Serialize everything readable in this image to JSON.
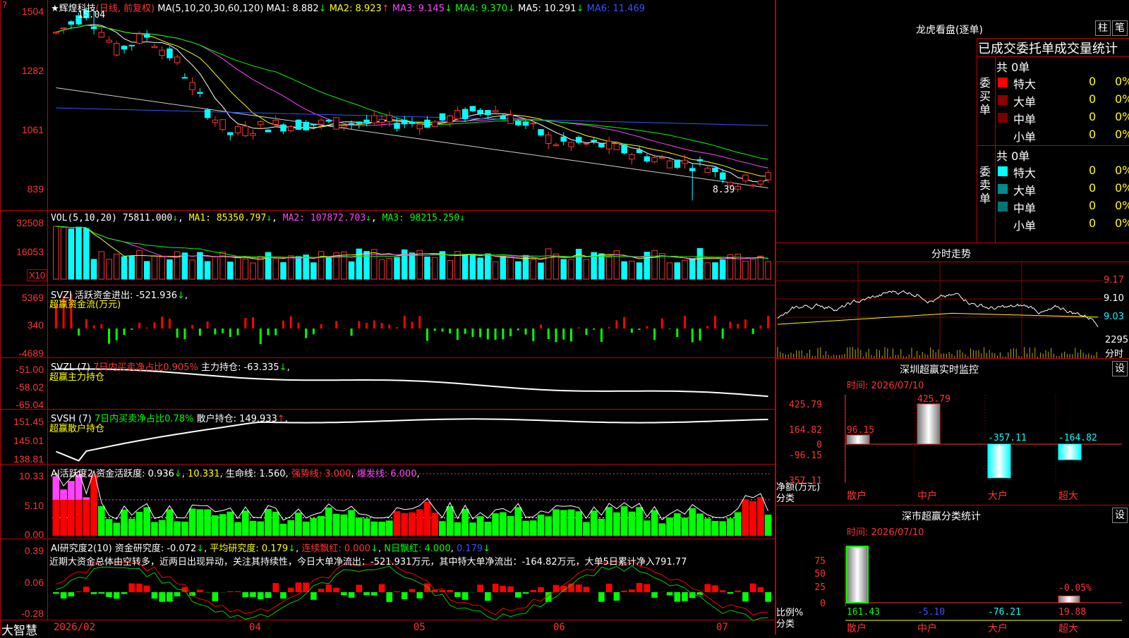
{
  "corner_mark": "?",
  "main": {
    "header": {
      "star": "★",
      "name": "辉煌科技",
      "period": "(日线, 前复权)",
      "ma_label": "MA(5,10,20,30,60,120)",
      "ma1": "MA1: 8.882",
      "ma2": "MA2: 8.923",
      "ma3": "MA3: 9.145",
      "ma4": "MA4: 9.370",
      "ma5": "MA5: 10.291",
      "ma6": "MA6: 11.469"
    },
    "high_label": "15.04",
    "low_label": "8.39",
    "yticks": [
      "1504",
      "1282",
      "1061",
      "839"
    ]
  },
  "vol": {
    "label": "VOL(5,10,20)",
    "value": "75811.000",
    "ma1": "MA1: 85350.797",
    "ma2": "MA2: 107872.703",
    "ma3": "MA3: 98215.250",
    "yticks": [
      "32508",
      "16053"
    ],
    "unit": "X10"
  },
  "svzj": {
    "label": "SVZJ",
    "title": "活跃资金进出: -521.936",
    "sub": "超赢资金流(万元)",
    "yticks": [
      "5369",
      "340",
      "-4689"
    ]
  },
  "svzl": {
    "label": "SVZL (7)",
    "ratio": "7日内买卖净占比0.905%",
    "hold": "主力持仓: -63.335",
    "sub": "超赢主力持仓",
    "yticks": [
      "-51.00",
      "-58.02",
      "-65.04"
    ]
  },
  "svsh": {
    "label": "SVSH (7)",
    "ratio": "7日内买卖净占比0.78%",
    "hold": "散户持仓: 149.933",
    "sub": "超赢散户持仓",
    "yticks": [
      "151.45",
      "145.01",
      "138.81"
    ]
  },
  "ai1": {
    "label": "AI活跃度2",
    "v1": "资金活跃度: 0.936",
    "v2": "10.331",
    "v3": "生命线: 1.560",
    "v4": "强势线: 3.000",
    "v5": "爆发线: 6.000",
    "yticks": [
      "10.33",
      "5.10",
      "0.00"
    ]
  },
  "ai2": {
    "label": "AI研究度2(10)",
    "v1": "资金研究度: -0.072",
    "v2": "平均研究度: 0.179",
    "v3": "连续飘红: 0.000",
    "v4": "N日飘红: 4.000",
    "v5": "0.179",
    "text": "近期大资金总体由空转多，近两日出现异动，关注其持续性，今日大单净流出：-521.931万元，其中特大单净流出：-164.82万元，大单5日累计净入791.77",
    "yticks": [
      "0.39",
      "0.06",
      "-0.28"
    ]
  },
  "xaxis": {
    "dates": [
      "2026/02",
      "04",
      "05",
      "06",
      "07"
    ],
    "logo": "大智慧"
  },
  "right": {
    "title": "龙虎看盘(逐单)",
    "btn_bar": "柱",
    "btn_pen": "笔",
    "stat_header": "已成交委托单成交量统计",
    "buy": {
      "group_label": "委买单",
      "total": "共 0单",
      "rows": [
        {
          "name": "特大",
          "val": "0",
          "pct": "0%"
        },
        {
          "name": "大单",
          "val": "0",
          "pct": "0%"
        },
        {
          "name": "中单",
          "val": "0",
          "pct": "0%"
        },
        {
          "name": "小单",
          "val": "0",
          "pct": "0%"
        }
      ]
    },
    "sell": {
      "group_label": "委卖单",
      "total": "共 0单",
      "rows": [
        {
          "name": "特大",
          "val": "0",
          "pct": "0%"
        },
        {
          "name": "大单",
          "val": "0",
          "pct": "0%"
        },
        {
          "name": "中单",
          "val": "0",
          "pct": "0%"
        },
        {
          "name": "小单",
          "val": "0",
          "pct": "0%"
        }
      ]
    },
    "intraday": {
      "title": "分时走势",
      "prices": [
        "9.17",
        "9.10",
        "9.03"
      ],
      "vol": "2295",
      "vol_unit": "分时"
    },
    "monitor": {
      "title": "深圳超赢实时监控",
      "set": "设",
      "time": "时间: 2026/07/10",
      "yticks": [
        "425.79",
        "164.82",
        "0",
        "-96.15",
        "-357.11"
      ],
      "bars": [
        {
          "label": "散户",
          "value": "96.15"
        },
        {
          "label": "中户",
          "value": "425.79"
        },
        {
          "label": "大户",
          "value": "-357.11"
        },
        {
          "label": "超大",
          "value": "-164.82"
        }
      ],
      "ylabel1": "净额(万元)",
      "ylabel2": "分类"
    },
    "category": {
      "title": "深市超赢分类统计",
      "set": "设",
      "time": "时间: 2026/07/10",
      "yticks": [
        "75",
        "50",
        "25",
        "0"
      ],
      "bars": [
        {
          "label": "散户",
          "value": "161.43"
        },
        {
          "label": "中户",
          "value": "-5.10"
        },
        {
          "label": "大户",
          "value": "-76.21"
        },
        {
          "label": "超大",
          "value": "19.88"
        }
      ],
      "pct_label": "-0.05%",
      "ylabel1": "比例%",
      "ylabel2": "分类"
    }
  },
  "chart_data": [
    {
      "type": "candlestick",
      "title": "辉煌科技",
      "ylim": [
        8.39,
        15.04
      ],
      "series": [
        {
          "name": "MA1",
          "value": 8.882
        },
        {
          "name": "MA2",
          "value": 8.923
        },
        {
          "name": "MA3",
          "value": 9.145
        },
        {
          "name": "MA4",
          "value": 9.37
        },
        {
          "name": "MA5",
          "value": 10.291
        },
        {
          "name": "MA6",
          "value": 11.469
        }
      ]
    },
    {
      "type": "bar",
      "title": "深圳超赢实时监控",
      "categories": [
        "散户",
        "中户",
        "大户",
        "超大"
      ],
      "values": [
        96.15,
        425.79,
        -357.11,
        -164.82
      ],
      "ylabel": "净额(万元)"
    },
    {
      "type": "bar",
      "title": "深市超赢分类统计",
      "categories": [
        "散户",
        "中户",
        "大户",
        "超大"
      ],
      "values": [
        161.43,
        -5.1,
        -76.21,
        19.88
      ],
      "ylabel": "比例%"
    }
  ]
}
